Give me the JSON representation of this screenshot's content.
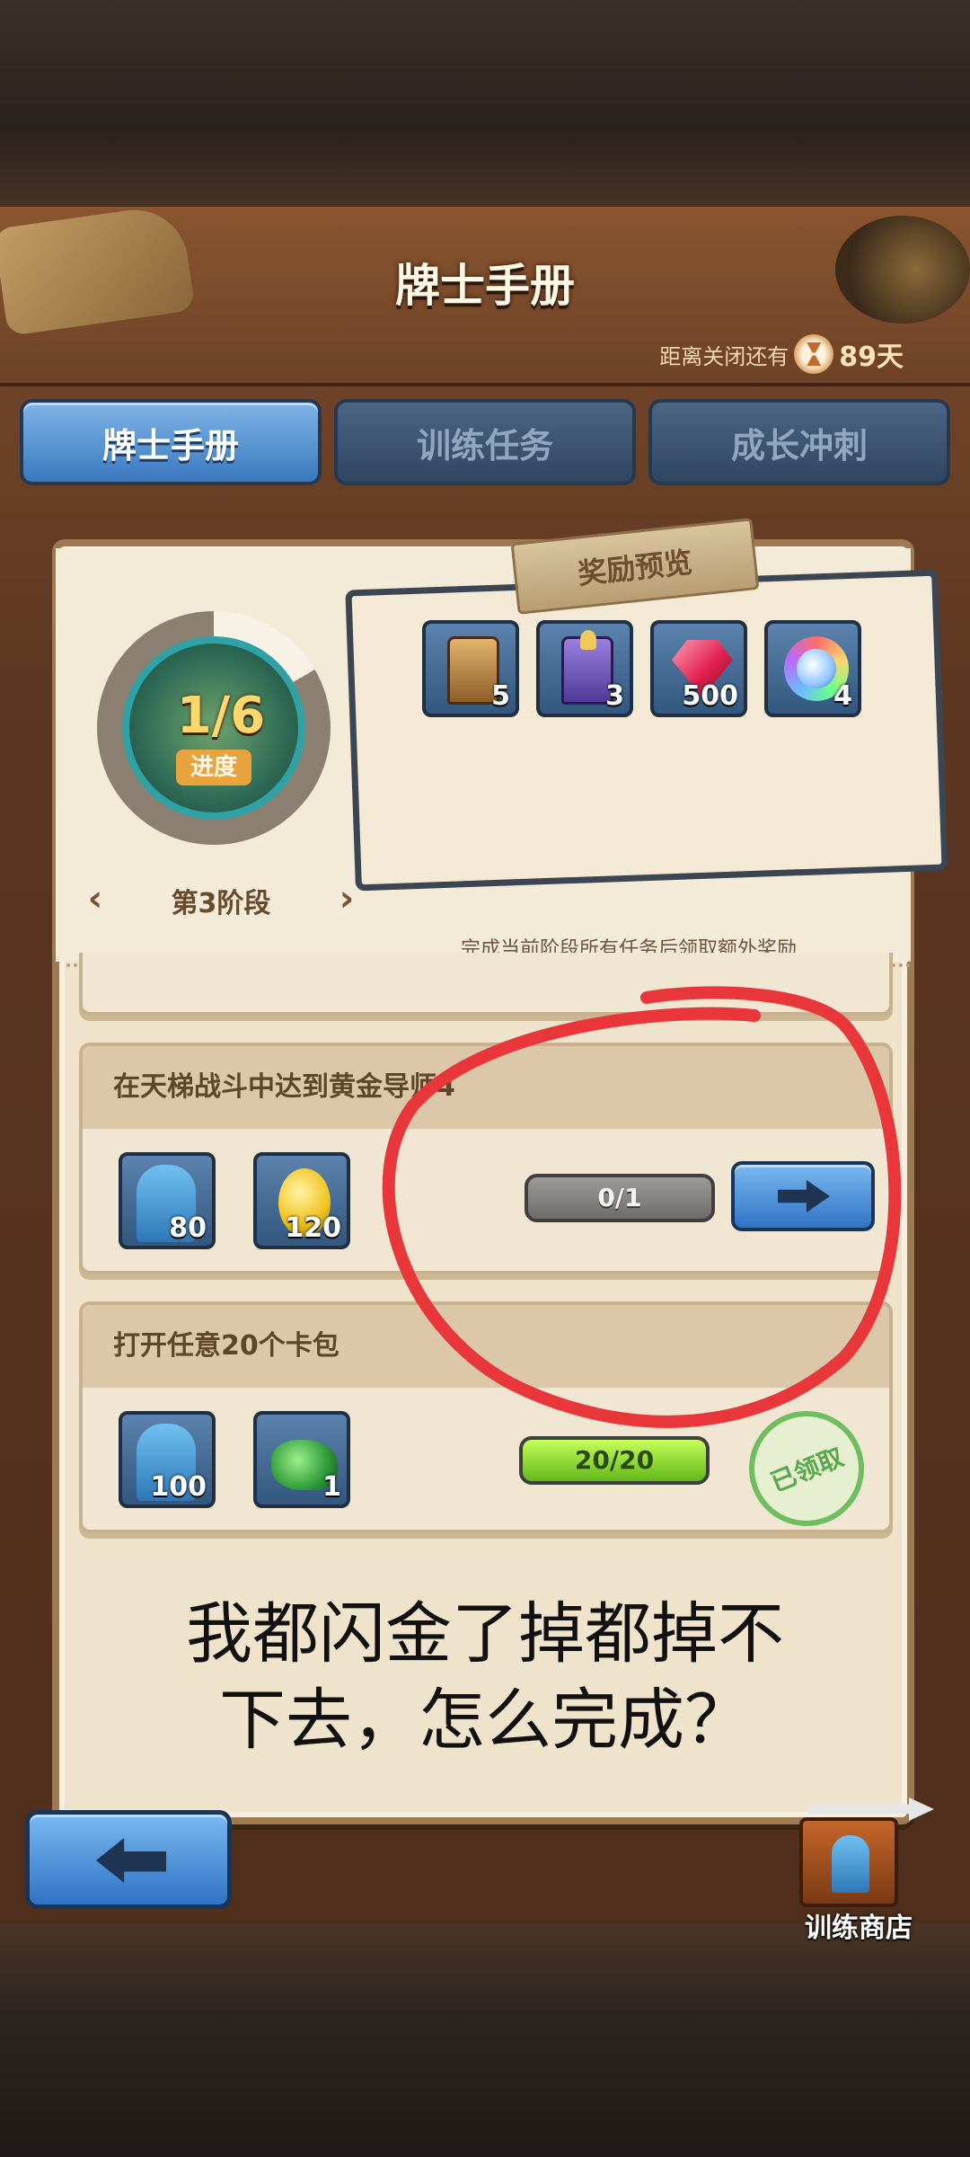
{
  "header": {
    "title": "牌士手册",
    "countdown_prefix": "距离关闭还有",
    "countdown_value": "89天"
  },
  "tabs": [
    {
      "label": "牌士手册",
      "active": true
    },
    {
      "label": "训练任务",
      "active": false
    },
    {
      "label": "成长冲刺",
      "active": false
    }
  ],
  "progress": {
    "value": "1/6",
    "label": "进度",
    "fraction": 0.1667,
    "stage": "第3阶段"
  },
  "reward_preview": {
    "title": "奖励预览",
    "items": [
      {
        "icon": "gold-card-pack-icon",
        "count": "5"
      },
      {
        "icon": "purple-card-pack-icon",
        "count": "3"
      },
      {
        "icon": "red-gem-icon",
        "count": "500"
      },
      {
        "icon": "rainbow-orb-icon",
        "count": "4"
      }
    ],
    "hint": "完成当前阶段所有任务后领取额外奖励"
  },
  "tasks": [
    {
      "title": "在天梯战斗中达到黄金导师4",
      "rewards": [
        {
          "icon": "character-exp-icon",
          "count": "80"
        },
        {
          "icon": "gold-coin-icon",
          "count": "120"
        }
      ],
      "progress": "0/1",
      "progress_fraction": 0,
      "status": "go"
    },
    {
      "title": "打开任意20个卡包",
      "rewards": [
        {
          "icon": "character-exp-icon",
          "count": "100"
        },
        {
          "icon": "green-slime-icon",
          "count": "1"
        }
      ],
      "progress": "20/20",
      "progress_fraction": 1,
      "status": "claimed",
      "claimed_label": "已领取"
    }
  ],
  "annotation": {
    "line1": "我都闪金了掉都掉不",
    "line2": "下去，怎么完成？",
    "circle_color": "#e8363a"
  },
  "footer": {
    "shop_label": "训练商店"
  },
  "colors": {
    "tab_active": "#3a78bf",
    "tab_inactive": "#2f4661",
    "paper": "#efe3cc",
    "bar_full": "#62b81a"
  }
}
